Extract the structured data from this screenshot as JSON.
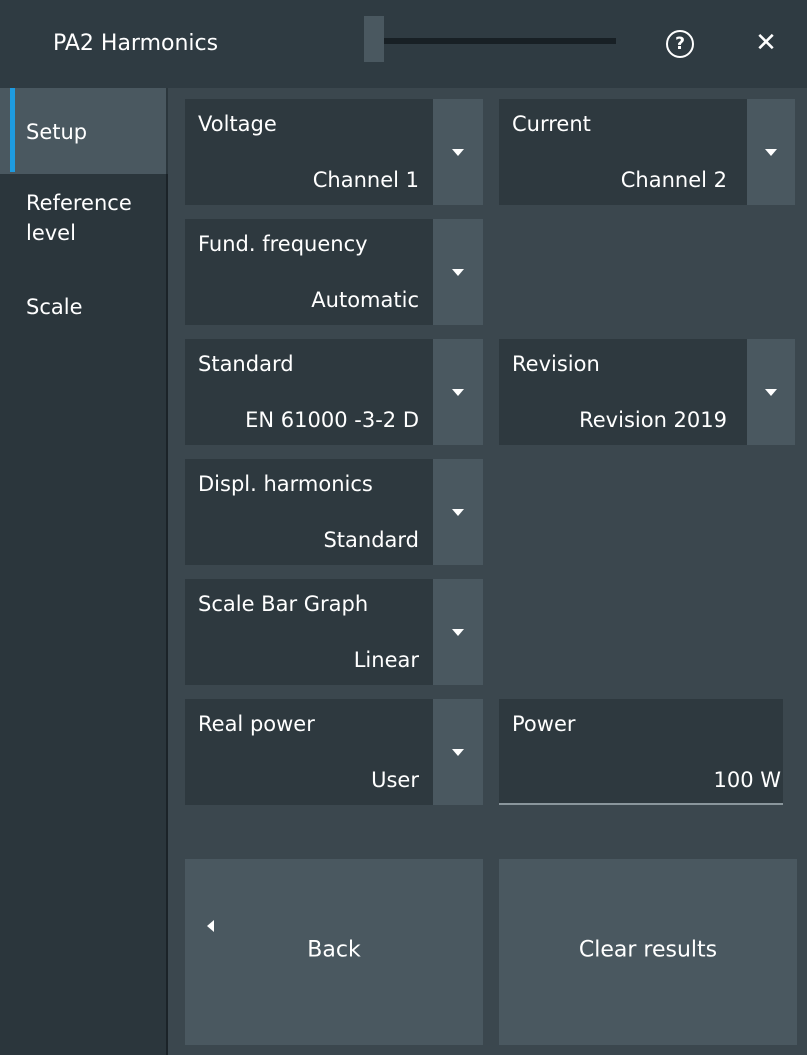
{
  "window": {
    "title": "PA2 Harmonics",
    "help_icon": "help-icon",
    "close_icon": "close-icon",
    "close_glyph": "✕",
    "help_glyph": "?"
  },
  "sidebar": {
    "items": [
      {
        "label": "Setup",
        "active": true
      },
      {
        "label": "Reference level",
        "active": false
      },
      {
        "label": "Scale",
        "active": false
      }
    ]
  },
  "setup": {
    "voltage": {
      "label": "Voltage",
      "value": "Channel 1"
    },
    "current": {
      "label": "Current",
      "value": "Channel 2"
    },
    "fund_frequency": {
      "label": "Fund. frequency",
      "value": "Automatic"
    },
    "standard": {
      "label": "Standard",
      "value": "EN 61000 -3-2 D"
    },
    "revision": {
      "label": "Revision",
      "value": "Revision 2019"
    },
    "displ_harmonics": {
      "label": "Displ. harmonics",
      "value": "Standard"
    },
    "scale_bar_graph": {
      "label": "Scale Bar Graph",
      "value": "Linear"
    },
    "real_power": {
      "label": "Real power",
      "value": "User"
    },
    "power": {
      "label": "Power",
      "value": "100 W"
    }
  },
  "buttons": {
    "back": "Back",
    "clear_results": "Clear results"
  },
  "colors": {
    "accent": "#1e9be0",
    "panel": "#3b474e",
    "field": "#2e393f",
    "dropdown": "#4a5860"
  }
}
